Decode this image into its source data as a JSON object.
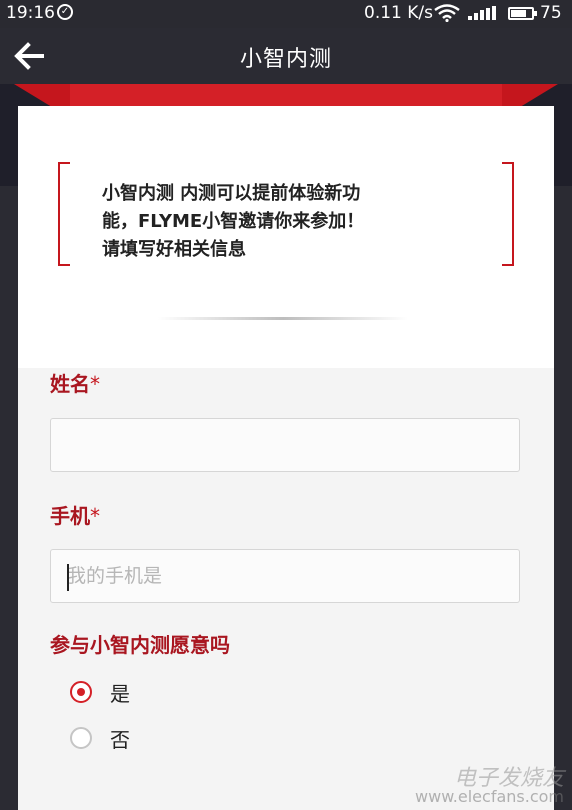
{
  "status_bar": {
    "time": "19:16",
    "speed": "0.11 K/s",
    "battery": "75",
    "battery_level": 0.75
  },
  "app_bar": {
    "title": "小智内测"
  },
  "intro": {
    "line1": "小智内测 内测可以提前体验新功",
    "line2": "能，FLYME小智邀请你来参加！",
    "line3": "请填写好相关信息"
  },
  "form": {
    "name_label": "姓名",
    "phone_label": "手机",
    "required_mark": "*",
    "name_value": "",
    "phone_placeholder": "我的手机是",
    "question": "参与小智内测愿意吗",
    "options": [
      {
        "label": "是",
        "selected": true
      },
      {
        "label": "否",
        "selected": false
      }
    ]
  },
  "watermark": {
    "brand": "电子发烧友",
    "url": "www.elecfans.com"
  },
  "colors": {
    "accent": "#d42027",
    "label": "#a91620",
    "bar": "#2b2b33"
  }
}
